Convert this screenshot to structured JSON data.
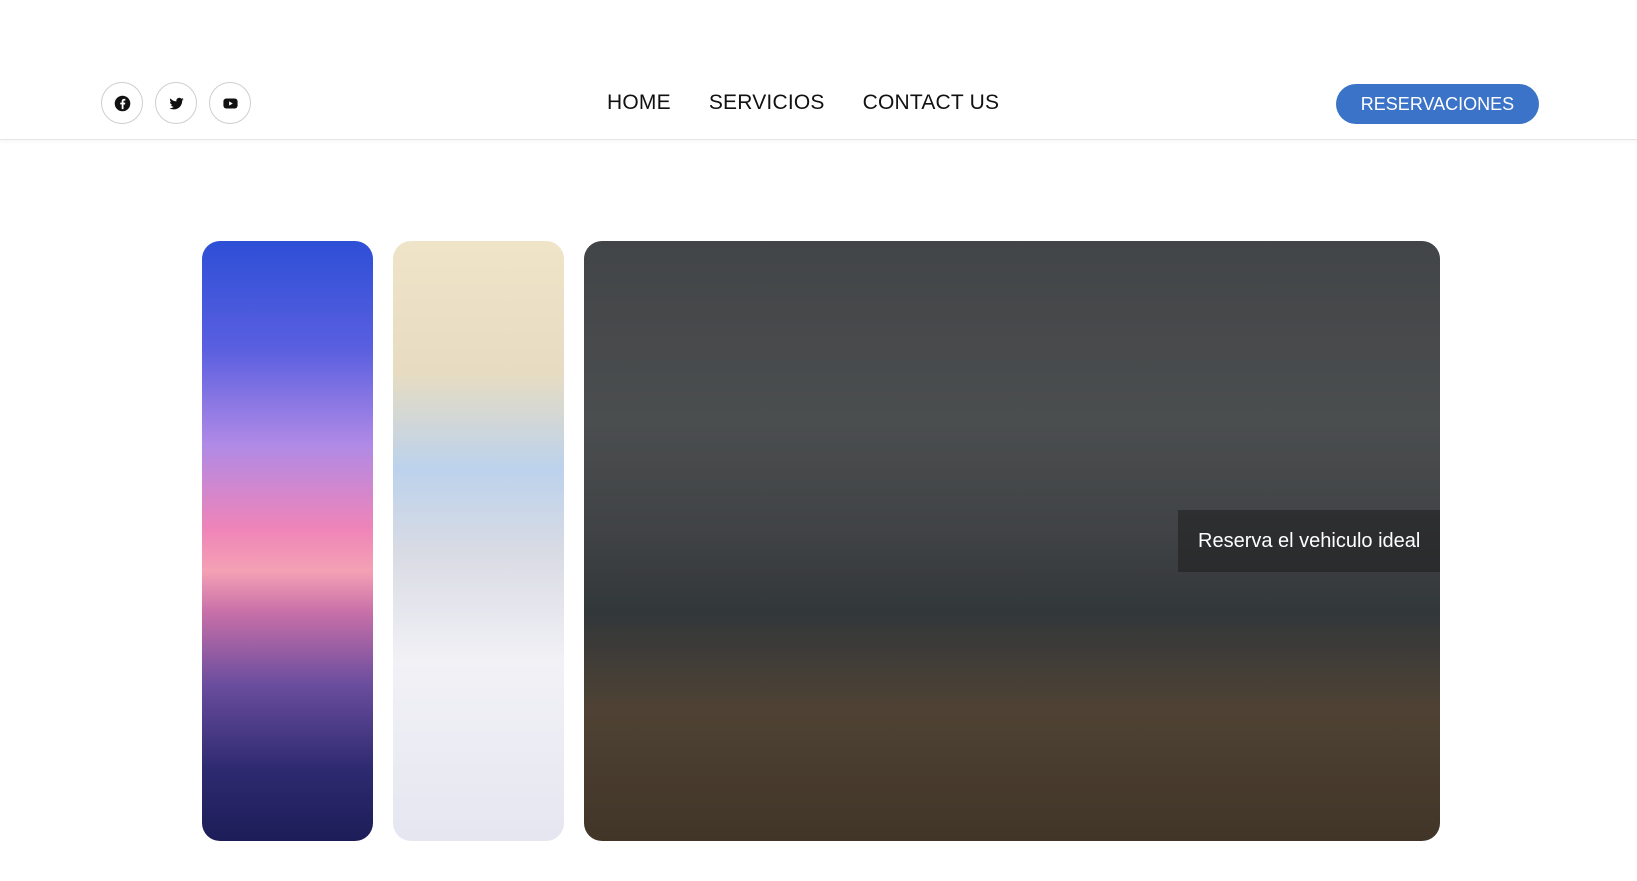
{
  "header": {
    "socials": [
      {
        "name": "facebook-icon"
      },
      {
        "name": "twitter-icon"
      },
      {
        "name": "youtube-icon"
      }
    ],
    "nav": [
      {
        "label": "HOME"
      },
      {
        "label": "SERVICIOS"
      },
      {
        "label": "CONTACT US"
      }
    ],
    "cta_label": "RESERVACIONES"
  },
  "gallery": {
    "caption": "Reserva el vehiculo ideal"
  },
  "colors": {
    "accent": "#3a73c7"
  }
}
